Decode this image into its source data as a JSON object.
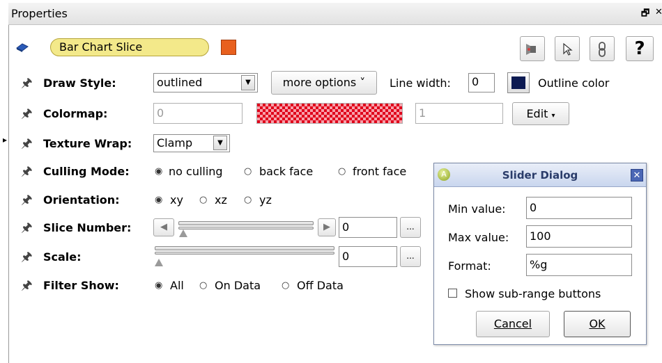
{
  "window": {
    "title": "Properties",
    "float_icon": "🗗",
    "close_icon": "✕"
  },
  "header": {
    "object_name": "Bar Chart Slice",
    "color_swatch": "#e8601e",
    "tool_icons": [
      "camera-icon",
      "pointer-icon",
      "link-icon",
      "help-icon"
    ],
    "help_glyph": "?"
  },
  "rows": {
    "draw_style": {
      "label": "Draw Style:",
      "value": "outlined",
      "more_options": "more options ˅",
      "line_width_label": "Line width:",
      "line_width": "0",
      "outline_color": "#0c1a52",
      "outline_label": "Outline color"
    },
    "colormap": {
      "label": "Colormap:",
      "min": "0",
      "max": "1",
      "edit": "Edit"
    },
    "texture_wrap": {
      "label": "Texture Wrap:",
      "value": "Clamp"
    },
    "culling_mode": {
      "label": "Culling Mode:",
      "options": [
        "no culling",
        "back face",
        "front face"
      ],
      "selected": 0
    },
    "orientation": {
      "label": "Orientation:",
      "options": [
        "xy",
        "xz",
        "yz"
      ],
      "selected": 0
    },
    "slice_number": {
      "label": "Slice Number:",
      "value": "0",
      "browse": "...",
      "slider_fraction": 0.0
    },
    "scale": {
      "label": "Scale:",
      "value": "0",
      "browse": "...",
      "slider_fraction": 0.0
    },
    "filter_show": {
      "label": "Filter Show:",
      "options": [
        "All",
        "On Data",
        "Off Data"
      ],
      "selected": 0
    }
  },
  "dialog": {
    "title": "Slider Dialog",
    "app_glyph": "A",
    "close_glyph": "✕",
    "min_label": "Min value:",
    "min_value": "0",
    "max_label": "Max value:",
    "max_value": "100",
    "format_label": "Format:",
    "format_value": "%g",
    "subrange_label": "Show sub-range buttons",
    "cancel": "Cancel",
    "ok": "OK"
  },
  "colors": {
    "name_pill_fill": "#f3e98a",
    "name_pill_border": "#b5a43a",
    "colormap_red": "#e0001b",
    "colormap_red_light": "#f7a0a9"
  }
}
